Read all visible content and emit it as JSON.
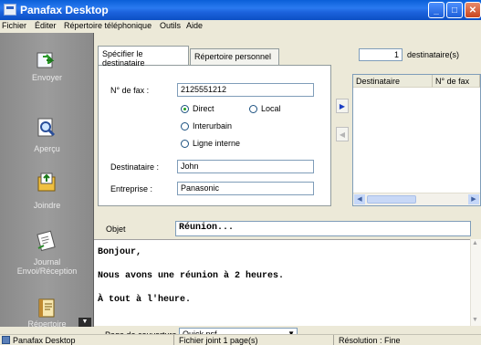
{
  "window": {
    "title": "Panafax Desktop"
  },
  "menu": [
    "Fichier",
    "Éditer",
    "Répertoire téléphonique",
    "Outils",
    "Aide"
  ],
  "sidebar": {
    "items": [
      {
        "label": "Envoyer",
        "icon": "send-fax-icon"
      },
      {
        "label": "Aperçu",
        "icon": "preview-magnifier-icon"
      },
      {
        "label": "Joindre",
        "icon": "attach-folder-icon"
      },
      {
        "label_line1": "Journal",
        "label_line2": "Envoi/Réception",
        "icon": "journal-icon"
      },
      {
        "label": "Répertoire",
        "icon": "directory-book-icon"
      }
    ]
  },
  "tabs": [
    {
      "label": "Spécifier le destinataire"
    },
    {
      "label": "Répertoire personnel"
    }
  ],
  "form": {
    "fax_label": "N° de fax :",
    "fax_value": "2125551212",
    "radio_direct": "Direct",
    "radio_local": "Local",
    "radio_interurbain": "Interurbain",
    "radio_ligne": "Ligne interne",
    "selected_radio": "Direct",
    "destinataire_label": "Destinataire :",
    "destinataire_value": "John",
    "entreprise_label": "Entreprise :",
    "entreprise_value": "Panasonic"
  },
  "recipients": {
    "count": "1",
    "count_suffix": "destinataire(s)",
    "columns": [
      "Destinataire",
      "N° de fax"
    ]
  },
  "message": {
    "objet_label": "Objet",
    "objet_value": "Réunion...",
    "lines": [
      "Bonjour,",
      "Nous avons une réunion à 2 heures.",
      "À tout à l'heure."
    ]
  },
  "cover": {
    "label": "Page de couverture",
    "value": "Quick.psf"
  },
  "status": {
    "app": "Panafax Desktop",
    "attached": "Fichier joint 1 page(s)",
    "resolution": "Résolution : Fine"
  },
  "colors": {
    "titlebar": "#1c63dd",
    "sidebar": "#8a8a8a",
    "accent_arrow": "#1c3fc4"
  }
}
